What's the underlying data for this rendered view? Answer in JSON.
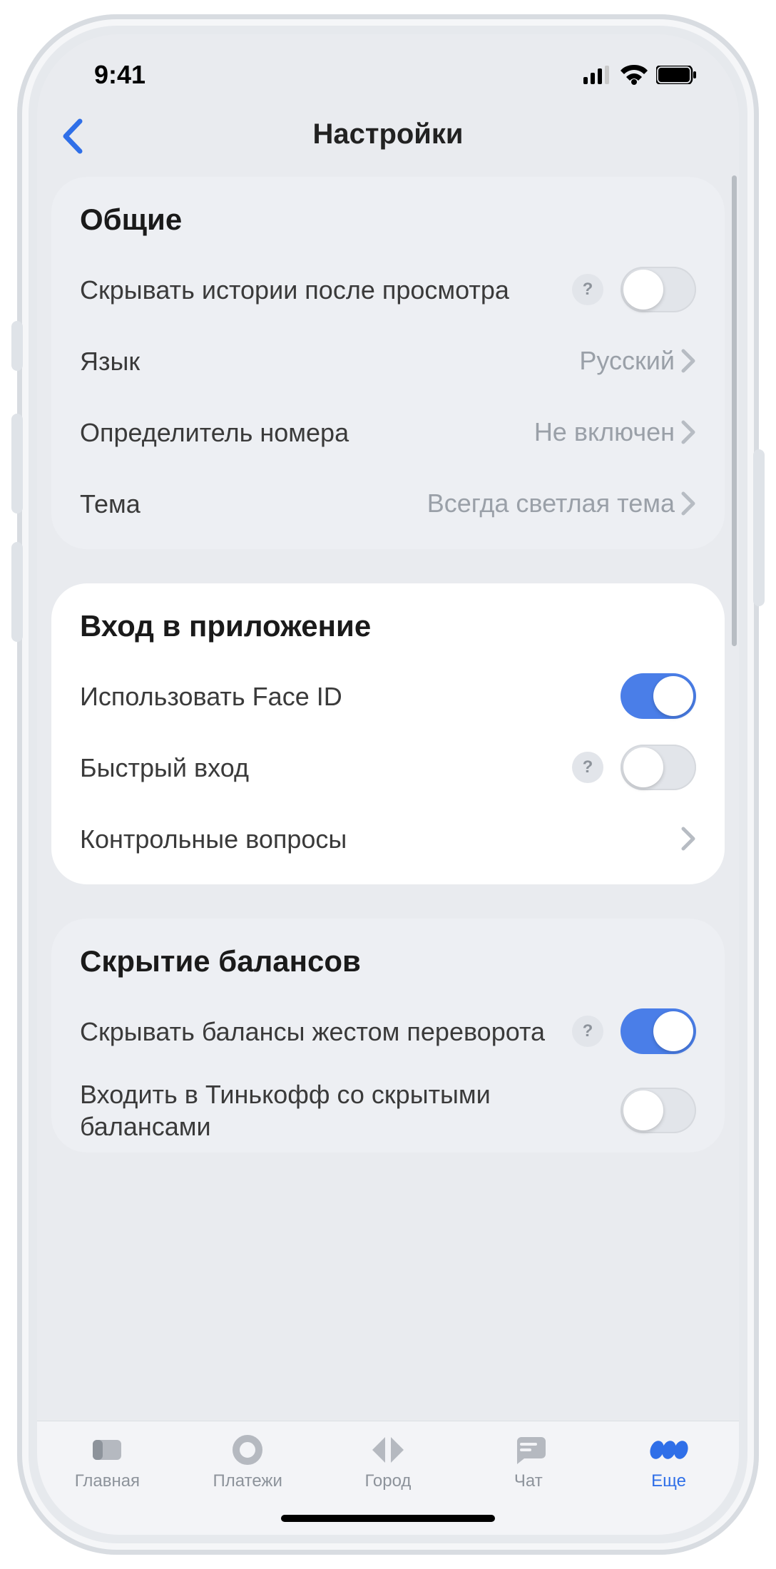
{
  "status": {
    "time": "9:41"
  },
  "nav": {
    "title": "Настройки"
  },
  "sections": {
    "general": {
      "title": "Общие",
      "hide_stories": {
        "label": "Скрывать истории после просмотра",
        "on": false,
        "help": true
      },
      "language": {
        "label": "Язык",
        "value": "Русский"
      },
      "caller_id": {
        "label": "Определитель номера",
        "value": "Не включен"
      },
      "theme": {
        "label": "Тема",
        "value": "Всегда светлая тема"
      }
    },
    "login": {
      "title": "Вход в приложение",
      "face_id": {
        "label": "Использовать Face ID",
        "on": true
      },
      "fast_login": {
        "label": "Быстрый вход",
        "on": false,
        "help": true
      },
      "questions": {
        "label": "Контрольные вопросы"
      }
    },
    "balances": {
      "title": "Скрытие балансов",
      "hide_flip": {
        "label": "Скрывать балансы жестом переворота",
        "on": true,
        "help": true
      },
      "hide_entry": {
        "label": "Входить в Тинькофф со скрытыми балансами",
        "on": false
      }
    }
  },
  "tabs": {
    "home": "Главная",
    "pay": "Платежи",
    "city": "Город",
    "chat": "Чат",
    "more": "Еще"
  }
}
